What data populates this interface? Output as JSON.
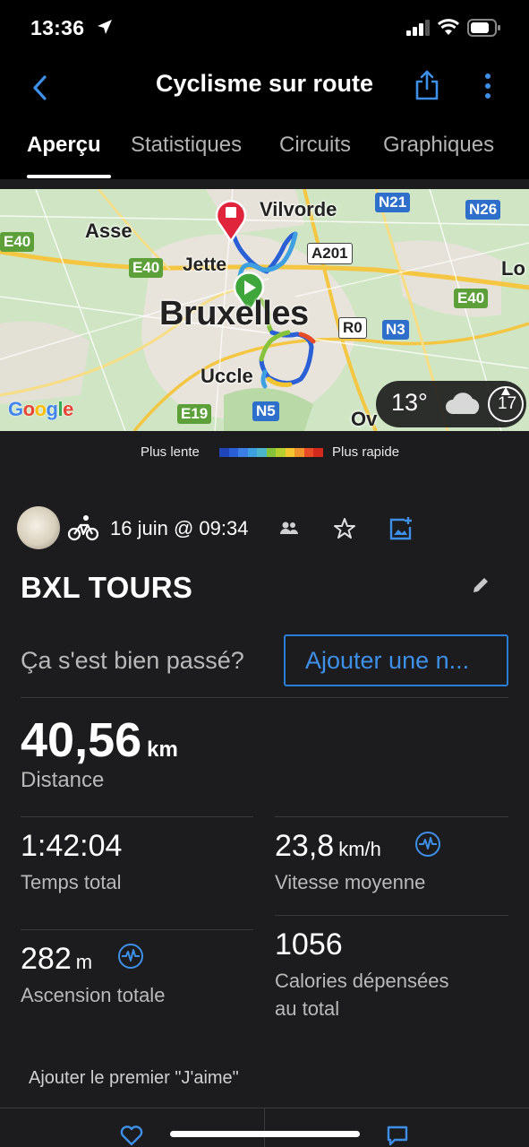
{
  "status_bar": {
    "time": "13:36"
  },
  "nav": {
    "title": "Cyclisme sur route",
    "tabs": [
      "Aperçu",
      "Statistiques",
      "Circuits",
      "Graphiques"
    ],
    "active_tab": "Aperçu"
  },
  "map": {
    "labels": {
      "vilvorde": "Vilvorde",
      "asse": "Asse",
      "jette": "Jette",
      "bruxelles": "Bruxelles",
      "uccle": "Uccle",
      "ov": "Ov",
      "lo": "Lo"
    },
    "road_badges": {
      "n21": "N21",
      "n26": "N26",
      "e40_left": "E40",
      "e40_mid": "E40",
      "a201": "A201",
      "e40_right": "E40",
      "r0": "R0",
      "n3": "N3",
      "e19": "E19",
      "n5": "N5"
    },
    "attribution": "Google",
    "weather": {
      "temperature": "13°",
      "condition_icon": "cloud-icon",
      "wind_speed": "17"
    },
    "route_colors": [
      "#2a5fd6",
      "#3ea0e0",
      "#86c23a",
      "#f5c431",
      "#e84a26"
    ]
  },
  "speed_legend": {
    "slow_label": "Plus lente",
    "fast_label": "Plus rapide",
    "colors": [
      "#1f45b8",
      "#2a5fd6",
      "#3b7fe6",
      "#3ea0e0",
      "#4db5c9",
      "#86c23a",
      "#b6cf2f",
      "#f5c431",
      "#f0932b",
      "#e84a26",
      "#d42a1e"
    ]
  },
  "activity": {
    "date": "16 juin @ 09:34",
    "title": "BXL TOURS",
    "feeling_prompt": "Ça s'est bien passé?",
    "add_note_label": "Ajouter une n..."
  },
  "stats": {
    "distance": {
      "value": "40,56",
      "unit": "km",
      "label": "Distance"
    },
    "total_time": {
      "value": "1:42:04",
      "label": "Temps total"
    },
    "avg_speed": {
      "value": "23,8",
      "unit": "km/h",
      "label": "Vitesse moyenne"
    },
    "ascent": {
      "value": "282",
      "unit": "m",
      "label": "Ascension totale"
    },
    "calories": {
      "value": "1056",
      "label_line1": "Calories dépensées",
      "label_line2": "au total"
    }
  },
  "social": {
    "first_like_prompt": "Ajouter le premier \"J'aime\""
  },
  "colors": {
    "accent": "#2a7ed8",
    "background": "#1c1c1e",
    "header": "#000000"
  }
}
